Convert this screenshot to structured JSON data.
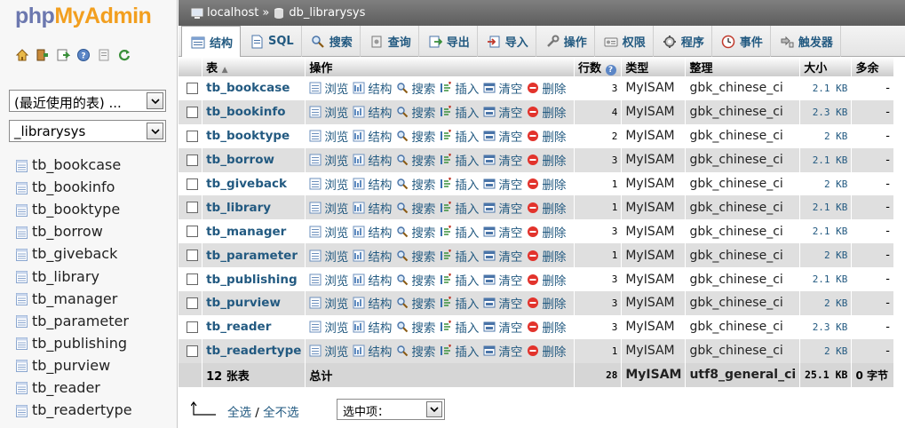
{
  "logo": {
    "php": "php",
    "myadmin": "MyAdmin"
  },
  "quick_icons": [
    "home-icon",
    "logout-icon",
    "query-window-icon",
    "docs-icon",
    "sql-docs-icon",
    "reload-icon"
  ],
  "recent_select": {
    "value": "(最近使用的表) ..."
  },
  "db_select": {
    "value": "_librarysys"
  },
  "sidebar_tables": [
    "tb_bookcase",
    "tb_bookinfo",
    "tb_booktype",
    "tb_borrow",
    "tb_giveback",
    "tb_library",
    "tb_manager",
    "tb_parameter",
    "tb_publishing",
    "tb_purview",
    "tb_reader",
    "tb_readertype"
  ],
  "breadcrumb": {
    "server": "localhost",
    "separator": "»",
    "database": "db_librarysys"
  },
  "tabs": [
    {
      "label": "结构",
      "icon": "structure-icon",
      "active": true
    },
    {
      "label": "SQL",
      "icon": "sql-icon"
    },
    {
      "label": "搜索",
      "icon": "search-icon"
    },
    {
      "label": "查询",
      "icon": "query-icon"
    },
    {
      "label": "导出",
      "icon": "export-icon"
    },
    {
      "label": "导入",
      "icon": "import-icon"
    },
    {
      "label": "操作",
      "icon": "operations-icon"
    },
    {
      "label": "权限",
      "icon": "privileges-icon"
    },
    {
      "label": "程序",
      "icon": "routines-icon"
    },
    {
      "label": "事件",
      "icon": "events-icon"
    },
    {
      "label": "触发器",
      "icon": "triggers-icon"
    }
  ],
  "columns": {
    "table": "表",
    "action": "操作",
    "rows": "行数",
    "type": "类型",
    "collation": "整理",
    "size": "大小",
    "overhead": "多余"
  },
  "actions": {
    "browse": "浏览",
    "structure": "结构",
    "search": "搜索",
    "insert": "插入",
    "empty": "清空",
    "drop": "删除"
  },
  "rows": [
    {
      "name": "tb_bookcase",
      "rows": "3",
      "type": "MyISAM",
      "collation": "gbk_chinese_ci",
      "size": "2.1 KB",
      "overhead": "-"
    },
    {
      "name": "tb_bookinfo",
      "rows": "4",
      "type": "MyISAM",
      "collation": "gbk_chinese_ci",
      "size": "2.3 KB",
      "overhead": "-"
    },
    {
      "name": "tb_booktype",
      "rows": "2",
      "type": "MyISAM",
      "collation": "gbk_chinese_ci",
      "size": "2 KB",
      "overhead": "-"
    },
    {
      "name": "tb_borrow",
      "rows": "3",
      "type": "MyISAM",
      "collation": "gbk_chinese_ci",
      "size": "2.1 KB",
      "overhead": "-"
    },
    {
      "name": "tb_giveback",
      "rows": "1",
      "type": "MyISAM",
      "collation": "gbk_chinese_ci",
      "size": "2 KB",
      "overhead": "-"
    },
    {
      "name": "tb_library",
      "rows": "1",
      "type": "MyISAM",
      "collation": "gbk_chinese_ci",
      "size": "2.1 KB",
      "overhead": "-"
    },
    {
      "name": "tb_manager",
      "rows": "3",
      "type": "MyISAM",
      "collation": "gbk_chinese_ci",
      "size": "2.1 KB",
      "overhead": "-"
    },
    {
      "name": "tb_parameter",
      "rows": "1",
      "type": "MyISAM",
      "collation": "gbk_chinese_ci",
      "size": "2 KB",
      "overhead": "-"
    },
    {
      "name": "tb_publishing",
      "rows": "3",
      "type": "MyISAM",
      "collation": "gbk_chinese_ci",
      "size": "2.1 KB",
      "overhead": "-"
    },
    {
      "name": "tb_purview",
      "rows": "3",
      "type": "MyISAM",
      "collation": "gbk_chinese_ci",
      "size": "2 KB",
      "overhead": "-"
    },
    {
      "name": "tb_reader",
      "rows": "3",
      "type": "MyISAM",
      "collation": "gbk_chinese_ci",
      "size": "2.3 KB",
      "overhead": "-"
    },
    {
      "name": "tb_readertype",
      "rows": "1",
      "type": "MyISAM",
      "collation": "gbk_chinese_ci",
      "size": "2 KB",
      "overhead": "-"
    }
  ],
  "footer": {
    "count": "12 张表",
    "total_label": "总计",
    "rows": "28",
    "type": "MyISAM",
    "collation": "utf8_general_ci",
    "size": "25.1 KB",
    "overhead": "0 字节"
  },
  "bottom": {
    "check_all": "全选",
    "separator": "/",
    "uncheck_all": "全不选",
    "with_selected": "选中项："
  },
  "colors": {
    "link": "#235a81",
    "logo_php": "#6c78af",
    "logo_myadmin": "#f29f1f",
    "row_alt": "#dfdfdf"
  }
}
